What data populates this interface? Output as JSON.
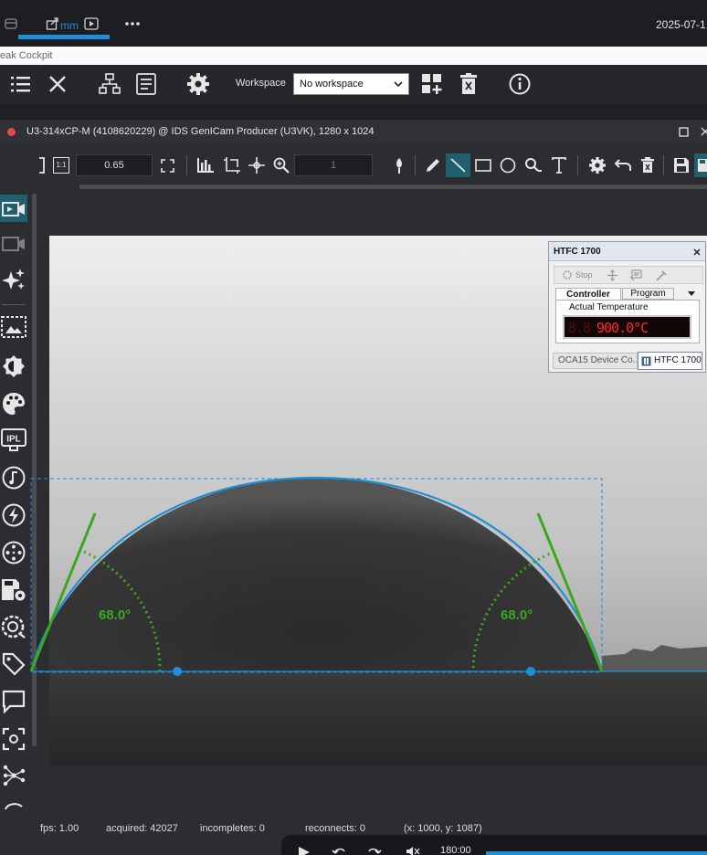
{
  "app": {
    "title_fragment": "eak Cockpit",
    "top_tab_label": "mm",
    "date_fragment": "2025-07-1"
  },
  "toolbar": {
    "workspace_label": "Workspace",
    "workspace_value": "No workspace"
  },
  "camera": {
    "title": "U3-314xCP-M (4108620229) @ IDS GenICam Producer (U3VK), 1280 x 1024",
    "zoom_value": "0.65",
    "frame_value": "1",
    "zoom_1to1": "1:1"
  },
  "measurement": {
    "left_angle": "68.0°",
    "right_angle": "68.0°"
  },
  "htfc": {
    "title": "HTFC 1700",
    "stop_label": "Stop",
    "tab_controller": "Controller",
    "tab_program": "Program",
    "actual_temp_label": "Actual Temperature",
    "display_ghost": "8.8",
    "display_value": "900.0°C",
    "bottom_tab_1": "OCA15 Device Co...",
    "bottom_tab_2": "HTFC 1700"
  },
  "status": {
    "fps": "fps: 1.00",
    "acquired": "acquired: 42027",
    "incompletes": "incompletes: 0",
    "reconnects": "reconnects: 0",
    "coords": "(x: 1000, y: 1087)"
  },
  "player": {
    "time": "180:00"
  },
  "colors": {
    "accent": "#1d8fd6",
    "sidebar_active": "#1f5f6e",
    "angle_line": "#3aa81e",
    "fit_curve": "#1d8fd6"
  },
  "icons": [
    "hamburger-list-icon",
    "close-x-icon",
    "network-icon",
    "document-icon",
    "gear-icon",
    "layout-add-icon",
    "trash-icon",
    "info-icon",
    "camera-icon",
    "sparkle-icon",
    "brightness-icon",
    "palette-icon",
    "ipl-icon",
    "music-icon",
    "bolt-icon",
    "film-reel-icon",
    "save-settings-icon",
    "camera-settings-icon",
    "tag-icon",
    "chat-icon",
    "focus-icon",
    "network-nodes-icon"
  ]
}
